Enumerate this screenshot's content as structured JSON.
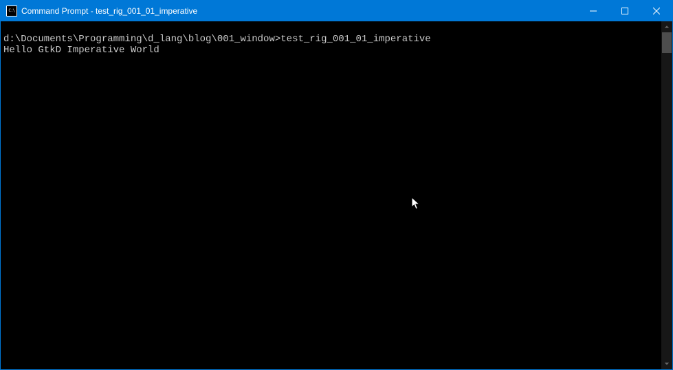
{
  "titlebar": {
    "icon_text": "C:\\",
    "title": "Command Prompt - test_rig_001_01_imperative"
  },
  "terminal": {
    "prompt_path": "d:\\Documents\\Programming\\d_lang\\blog\\001_window>",
    "command": "test_rig_001_01_imperative",
    "output_line": "Hello GtkD Imperative World"
  }
}
